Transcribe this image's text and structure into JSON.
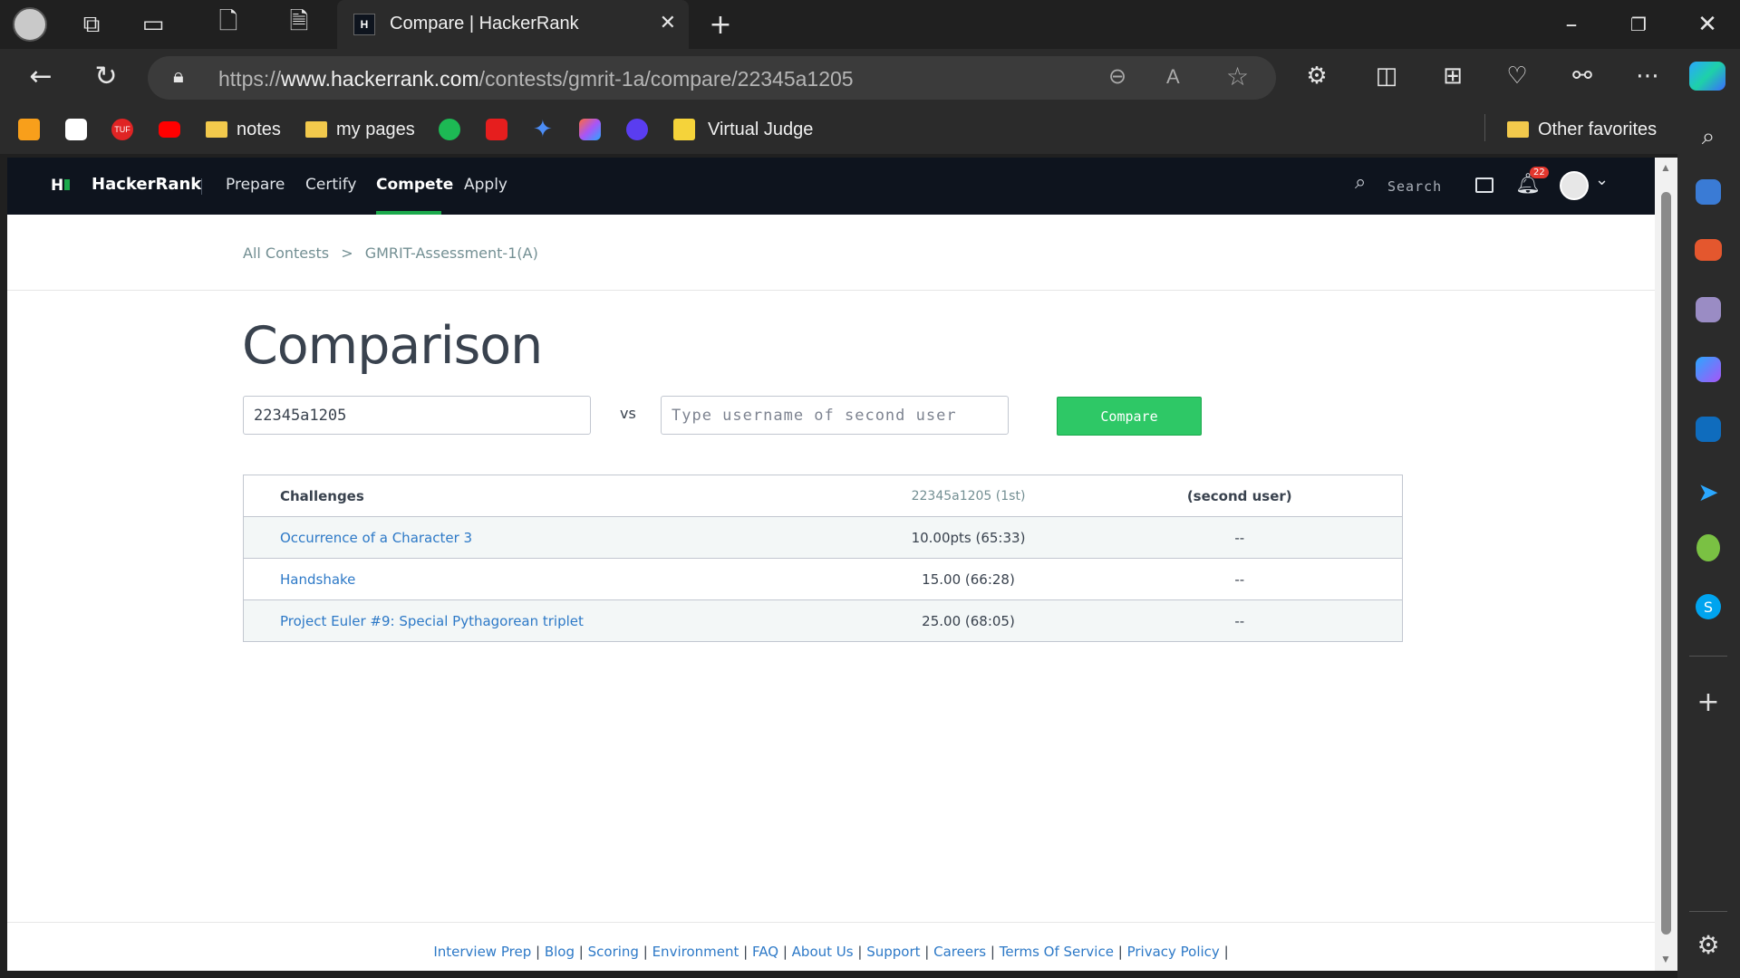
{
  "browser": {
    "tab_title": "Compare | HackerRank",
    "tab_favicon_text": "H",
    "url_prefix": "https://",
    "url_domain": "www.hackerrank.com",
    "url_path": "/contests/gmrit-1a/compare/22345a1205"
  },
  "favorites": {
    "notes": "notes",
    "my_pages": "my pages",
    "virtual_judge": "Virtual Judge",
    "other": "Other favorites",
    "tuf_label": "TUF"
  },
  "nav": {
    "brand": "HackerRank",
    "logo": "H",
    "prepare": "Prepare",
    "certify": "Certify",
    "compete": "Compete",
    "apply": "Apply",
    "search_placeholder": "Search",
    "notification_count": "22"
  },
  "breadcrumb": {
    "all_contests": "All Contests",
    "separator": ">",
    "contest": "GMRIT-Assessment-1(A)"
  },
  "main": {
    "title": "Comparison",
    "first_user_value": "22345a1205",
    "vs": "vs",
    "second_user_placeholder": "Type username of second user",
    "compare_label": "Compare"
  },
  "table": {
    "headers": [
      "Challenges",
      "22345a1205 (1st)",
      "(second user)"
    ],
    "rows": [
      {
        "challenge": "Occurrence of a Character 3",
        "first": "10.00pts (65:33)",
        "second": "--"
      },
      {
        "challenge": "Handshake",
        "first": "15.00 (66:28)",
        "second": "--"
      },
      {
        "challenge": "Project Euler #9: Special Pythagorean triplet",
        "first": "25.00 (68:05)",
        "second": "--"
      }
    ]
  },
  "footer": {
    "links": [
      "Interview Prep",
      "Blog",
      "Scoring",
      "Environment",
      "FAQ",
      "About Us",
      "Support",
      "Careers",
      "Terms Of Service",
      "Privacy Policy"
    ],
    "separator": "|"
  },
  "colors": {
    "nav_bg": "#0e141e",
    "accent_green": "#2ec866",
    "link_blue": "#2d79c7"
  }
}
